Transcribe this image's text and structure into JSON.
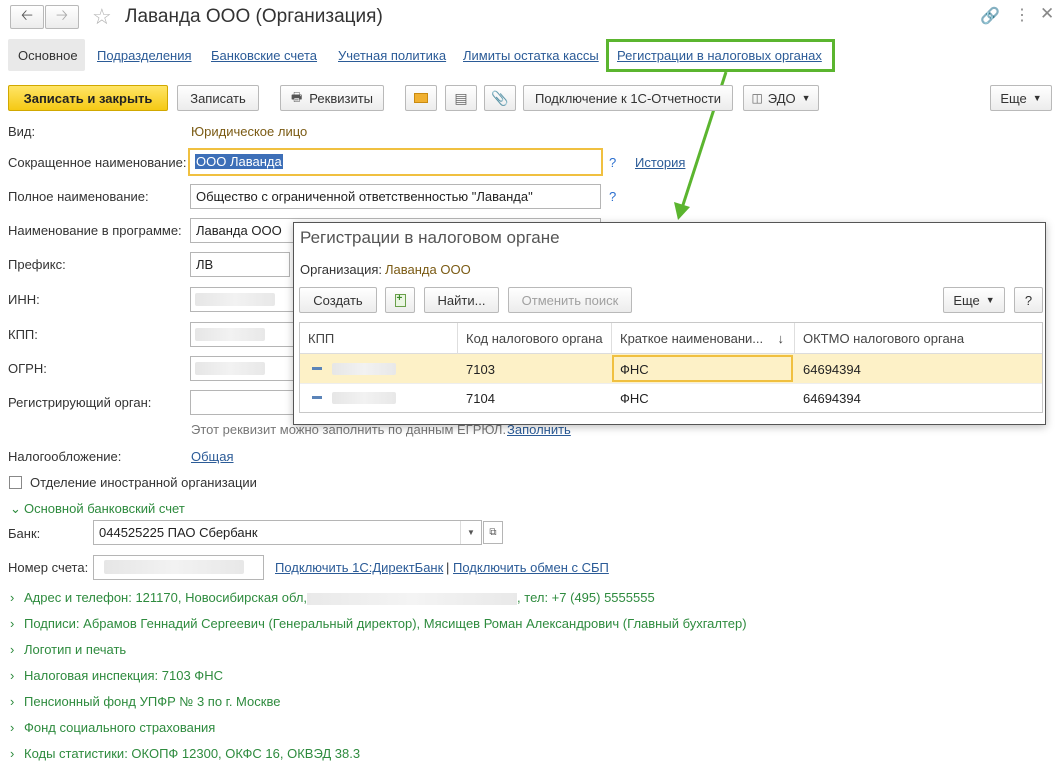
{
  "window": {
    "title": "Лаванда ООО (Организация)"
  },
  "tabs": {
    "main": "Основное",
    "subdivisions": "Подразделения",
    "bank_accounts": "Банковские счета",
    "accounting_policy": "Учетная политика",
    "cash_limits": "Лимиты остатка кассы",
    "tax_registrations": "Регистрации в налоговых органах"
  },
  "toolbar": {
    "save_close": "Записать и закрыть",
    "save": "Записать",
    "requisites": "Реквизиты",
    "reporting": "Подключение к 1С-Отчетности",
    "edo": "ЭДО",
    "more": "Еще"
  },
  "form": {
    "kind_label": "Вид:",
    "kind_value": "Юридическое лицо",
    "short_name_label": "Сокращенное наименование:",
    "short_name_value": "ООО Лаванда",
    "history_link": "История",
    "full_name_label": "Полное наименование:",
    "full_name_value": "Общество с ограниченной ответственностью \"Лаванда\"",
    "program_name_label": "Наименование в программе:",
    "program_name_value": "Лаванда ООО",
    "prefix_label": "Префикс:",
    "prefix_value": "ЛВ",
    "inn_label": "ИНН:",
    "kpp_label": "КПП:",
    "ogrn_label": "ОГРН:",
    "reg_authority_label": "Регистрирующий орган:",
    "egrul_hint": "Этот реквизит можно заполнить по данным ЕГРЮЛ.",
    "fill_link": "Заполнить",
    "taxation_label": "Налогообложение:",
    "taxation_link": "Общая",
    "foreign_branch_label": "Отделение иностранной организации",
    "bank_section_title": "Основной банковский счет",
    "bank_label": "Банк:",
    "bank_value": "044525225 ПАО Сбербанк",
    "account_label": "Номер счета:",
    "directbank_link": "Подключить 1С:ДиректБанк",
    "separator": "|",
    "sbp_link": "Подключить обмен с СБП",
    "help_mark": "?"
  },
  "groups": {
    "address_prefix": "Адрес и телефон: 121170, Новосибирская обл,",
    "address_suffix": ", тел: +7 (495) 5555555",
    "signatures": "Подписи: Абрамов Геннадий Сергеевич (Генеральный директор), Мясищев Роман Александрович (Главный бухгалтер)",
    "logo": "Логотип и печать",
    "tax_inspection": "Налоговая инспекция: 7103 ФНС",
    "pension_fund": "Пенсионный фонд УПФР № 3 по г. Москве",
    "social_insurance": "Фонд социального страхования",
    "stat_codes": "Коды статистики: ОКОПФ 12300, ОКФС 16, ОКВЭД 38.3"
  },
  "dialog": {
    "title": "Регистрации в налоговом органе",
    "org_label": "Организация:",
    "org_value": "Лаванда ООО",
    "create": "Создать",
    "find": "Найти...",
    "cancel_search": "Отменить поиск",
    "more": "Еще",
    "help": "?",
    "columns": [
      "КПП",
      "Код налогового органа",
      "Краткое наименовани...",
      "ОКТМО налогового органа"
    ],
    "sort_arrow": "↓",
    "rows": [
      {
        "code": "7103",
        "short_name": "ФНС",
        "oktmo": "64694394"
      },
      {
        "code": "7104",
        "short_name": "ФНС",
        "oktmo": "64694394"
      }
    ]
  },
  "colors": {
    "accent_green": "#5bb52f",
    "primary_button": "#f5c914",
    "selected_row": "#fdf1c7",
    "link": "#2b5b97"
  }
}
